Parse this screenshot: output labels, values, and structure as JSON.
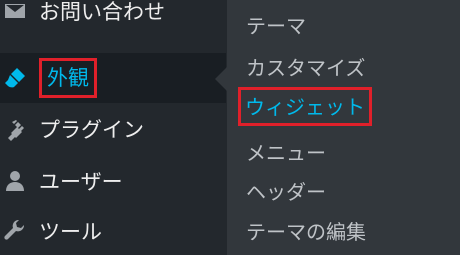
{
  "sidebar": {
    "items": [
      {
        "label": "お問い合わせ",
        "icon": "envelope-icon"
      },
      {
        "label": "外観",
        "icon": "paintbrush-icon",
        "active": true
      },
      {
        "label": "プラグイン",
        "icon": "plugin-icon"
      },
      {
        "label": "ユーザー",
        "icon": "user-icon"
      },
      {
        "label": "ツール",
        "icon": "wrench-icon"
      }
    ]
  },
  "submenu": {
    "items": [
      {
        "label": "テーマ"
      },
      {
        "label": "カスタマイズ"
      },
      {
        "label": "ウィジェット",
        "current": true
      },
      {
        "label": "メニュー"
      },
      {
        "label": "ヘッダー"
      },
      {
        "label": "テーマの編集"
      }
    ]
  },
  "colors": {
    "sidebar_bg": "#23282d",
    "active_bg": "#191e23",
    "submenu_bg": "#32373c",
    "accent": "#00b9eb",
    "highlight_box": "#e0202a"
  }
}
